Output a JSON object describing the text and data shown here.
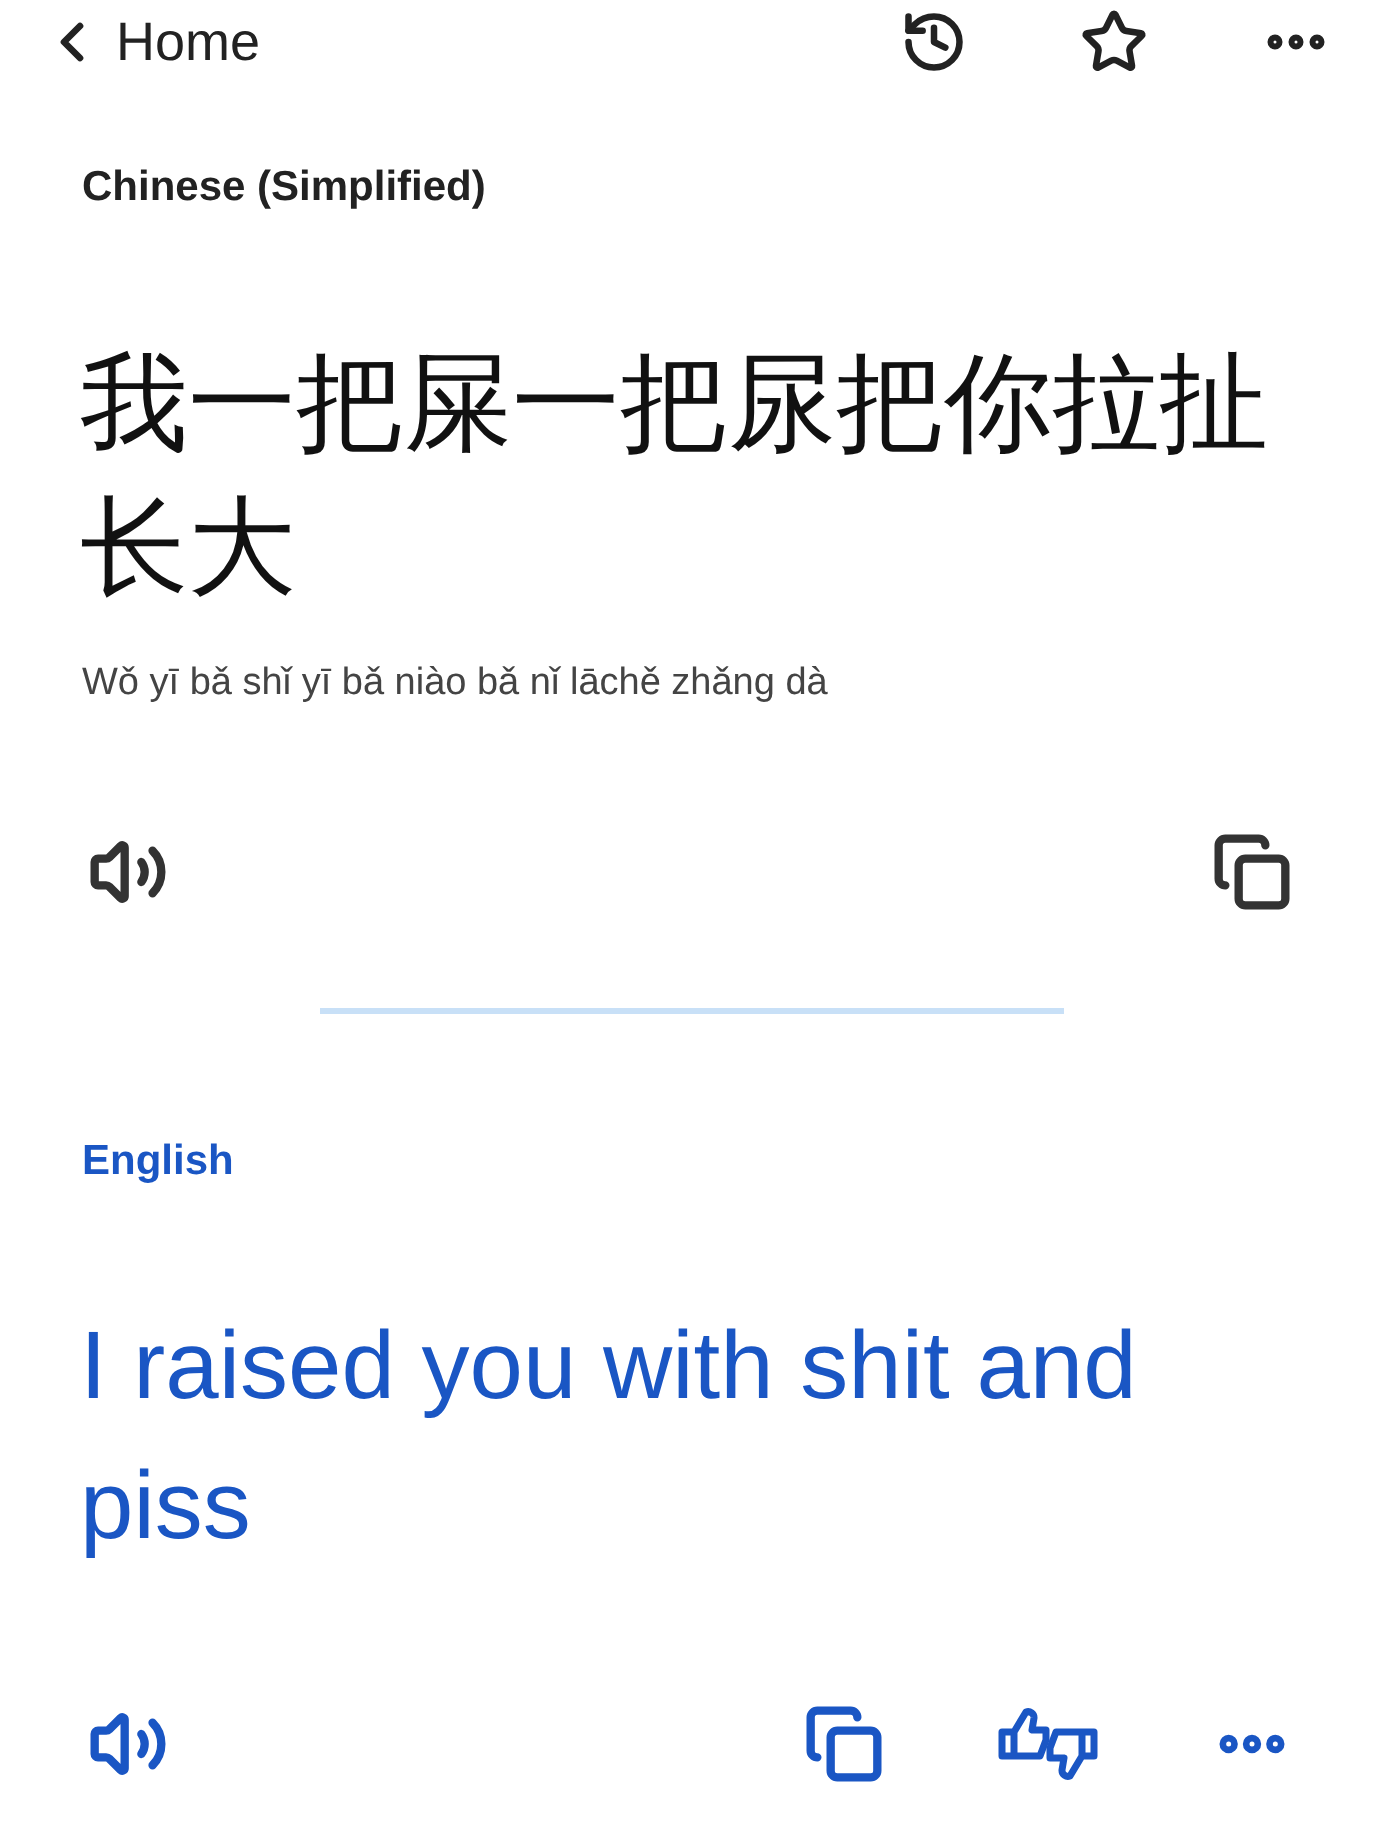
{
  "top_bar": {
    "back_label": "Home"
  },
  "source": {
    "language": "Chinese (Simplified)",
    "text": "我一把屎一把尿把你拉扯长大",
    "romanization": "Wǒ yī bǎ shǐ yī bǎ niào bǎ nǐ lāchě zhǎng dà"
  },
  "target": {
    "language": "English",
    "text": "I raised you with shit and piss"
  }
}
